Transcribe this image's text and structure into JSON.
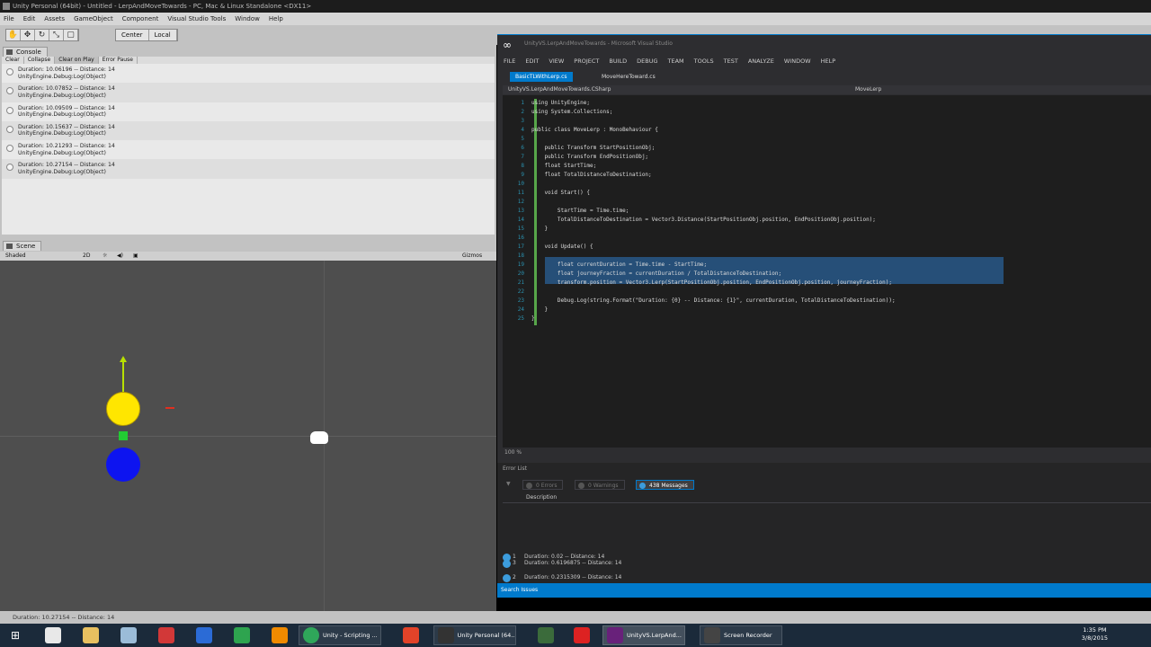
{
  "unity": {
    "title": "Unity Personal (64bit) - Untitled - LerpAndMoveTowards - PC, Mac & Linux Standalone <DX11>",
    "menu": [
      "File",
      "Edit",
      "Assets",
      "GameObject",
      "Component",
      "Visual Studio Tools",
      "Window",
      "Help"
    ],
    "toolbar": {
      "tools": [
        "hand",
        "move",
        "rotate",
        "scale",
        "rect"
      ],
      "pivot_mode": "Center",
      "pivot_space": "Local"
    },
    "console": {
      "tab_label": "Console",
      "buttons": [
        "Clear",
        "Collapse",
        "Clear on Play",
        "Error Pause"
      ],
      "logs": [
        {
          "line1": "Duration: 10.06196 -- Distance: 14",
          "line2": "UnityEngine.Debug:Log(Object)"
        },
        {
          "line1": "Duration: 10.07852 -- Distance: 14",
          "line2": "UnityEngine.Debug:Log(Object)"
        },
        {
          "line1": "Duration: 10.09509 -- Distance: 14",
          "line2": "UnityEngine.Debug:Log(Object)"
        },
        {
          "line1": "Duration: 10.15637 -- Distance: 14",
          "line2": "UnityEngine.Debug:Log(Object)"
        },
        {
          "line1": "Duration: 10.21293 -- Distance: 14",
          "line2": "UnityEngine.Debug:Log(Object)"
        },
        {
          "line1": "Duration: 10.27154 -- Distance: 14",
          "line2": "UnityEngine.Debug:Log(Object)"
        }
      ]
    },
    "scene": {
      "tab_label": "Scene",
      "shading": "Shaded",
      "mode_2d": "2D",
      "gizmos": "Gizmos"
    },
    "status": "Duration: 10.27154 -- Distance: 14"
  },
  "vs": {
    "title": "UnityVS.LerpAndMoveTowards - Microsoft Visual Studio",
    "menu": [
      "FILE",
      "EDIT",
      "VIEW",
      "PROJECT",
      "BUILD",
      "DEBUG",
      "TEAM",
      "TOOLS",
      "TEST",
      "ANALYZE",
      "WINDOW",
      "HELP"
    ],
    "tabs": [
      "BasicTLWithLerp.cs",
      "MoveHereToward.cs"
    ],
    "nav_left": "UnityVS.LerpAndMoveTowards.CSharp",
    "nav_right": "MoveLerp",
    "code": [
      {
        "n": "1",
        "text": "using UnityEngine;"
      },
      {
        "n": "2",
        "text": "using System.Collections;"
      },
      {
        "n": "3",
        "text": ""
      },
      {
        "n": "4",
        "text": "public class MoveLerp : MonoBehaviour {"
      },
      {
        "n": "5",
        "text": ""
      },
      {
        "n": "6",
        "text": "    public Transform StartPositionObj;"
      },
      {
        "n": "7",
        "text": "    public Transform EndPositionObj;"
      },
      {
        "n": "8",
        "text": "    float StartTime;"
      },
      {
        "n": "9",
        "text": "    float TotalDistanceToDestination;"
      },
      {
        "n": "10",
        "text": ""
      },
      {
        "n": "11",
        "text": "    void Start() {"
      },
      {
        "n": "12",
        "text": ""
      },
      {
        "n": "13",
        "text": "        StartTime = Time.time;"
      },
      {
        "n": "14",
        "text": "        TotalDistanceToDestination = Vector3.Distance(StartPositionObj.position, EndPositionObj.position);"
      },
      {
        "n": "15",
        "text": "    }"
      },
      {
        "n": "16",
        "text": ""
      },
      {
        "n": "17",
        "text": "    void Update() {"
      },
      {
        "n": "18",
        "text": ""
      },
      {
        "n": "19",
        "text": "        float currentDuration = Time.time - StartTime;"
      },
      {
        "n": "20",
        "text": "        float journeyFraction = currentDuration / TotalDistanceToDestination;"
      },
      {
        "n": "21",
        "text": "        transform.position = Vector3.Lerp(StartPositionObj.position, EndPositionObj.position, journeyFraction);"
      },
      {
        "n": "22",
        "text": ""
      },
      {
        "n": "23",
        "text": "        Debug.Log(string.Format(\"Duration: {0} -- Distance: {1}\", currentDuration, TotalDistanceToDestination));"
      },
      {
        "n": "24",
        "text": "    }"
      },
      {
        "n": "25",
        "text": "}"
      }
    ],
    "zoom": "100 %",
    "error_list": {
      "title": "Error List",
      "filters": [
        "0 Errors",
        "0 Warnings",
        "438 Messages"
      ],
      "header": "Description",
      "rows": [
        {
          "idx": "1",
          "text": "Duration: 0.02 -- Distance: 14"
        },
        {
          "idx": "2",
          "text": "Duration: 0.2315309 -- Distance: 14"
        },
        {
          "idx": "3",
          "text": "Duration: 0.6196875 -- Distance: 14"
        }
      ]
    },
    "status": "Search Issues"
  },
  "taskbar": {
    "items": [
      "Unity - Scripting ...",
      "Unity Personal (64...",
      "UnityVS.LerpAnd...",
      "Screen Recorder"
    ],
    "time": "1:35 PM",
    "date": "3/8/2015"
  }
}
